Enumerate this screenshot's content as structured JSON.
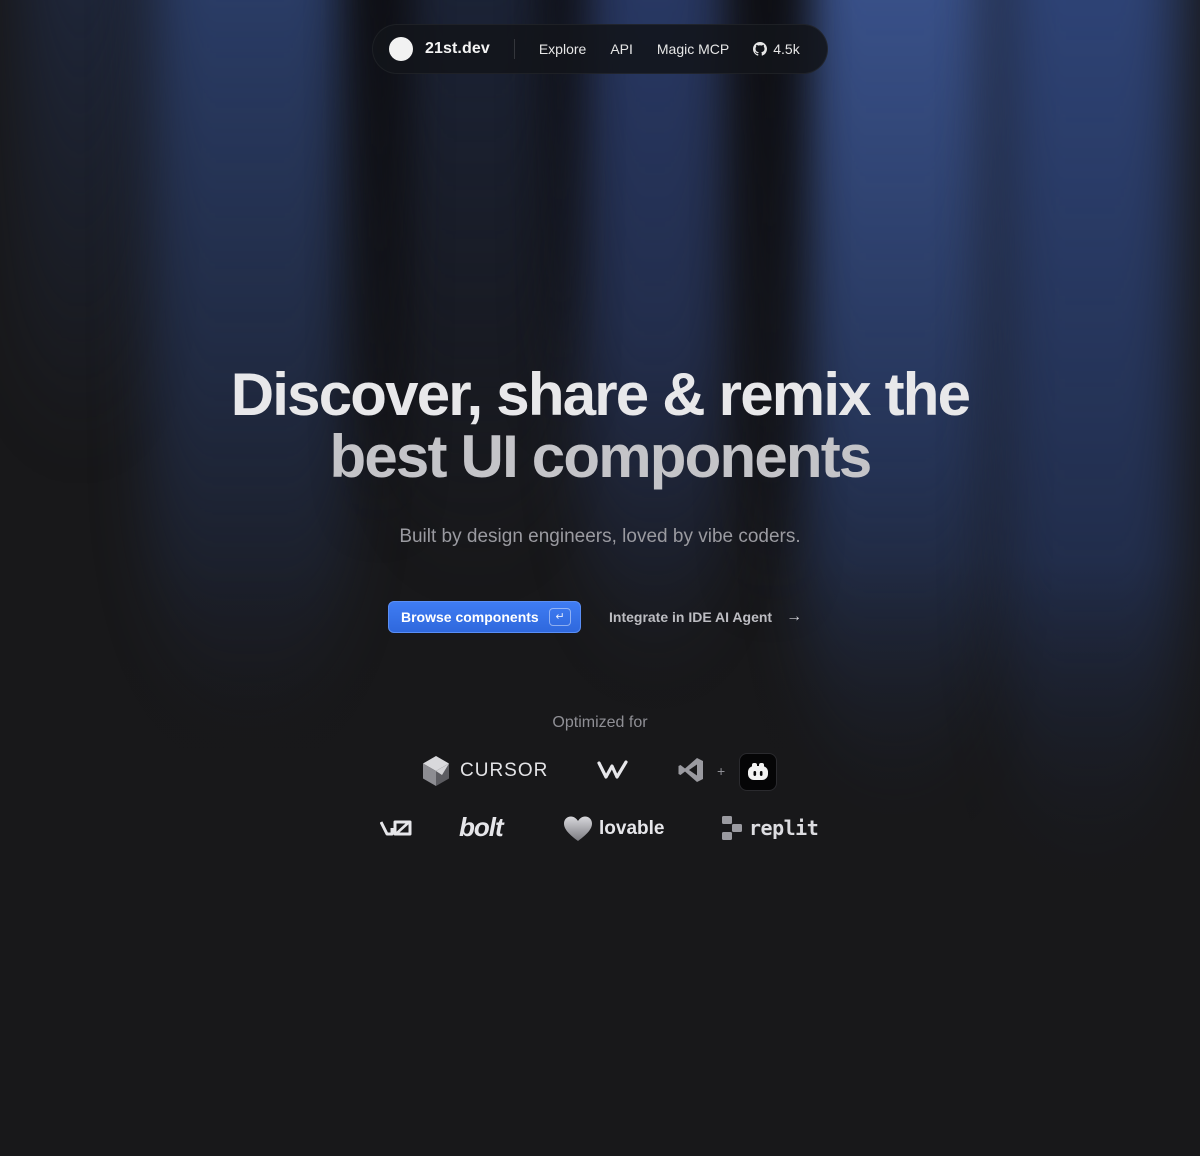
{
  "nav": {
    "brand": "21st.dev",
    "links": [
      "Explore",
      "API",
      "Magic MCP"
    ],
    "github_stars": "4.5k",
    "github_icon": "github-icon"
  },
  "hero": {
    "title_line1": "Discover, share & remix the",
    "title_line2": "best UI components",
    "subtitle": "Built by design engineers, loved by vibe coders."
  },
  "cta": {
    "primary_label": "Browse components",
    "primary_shortcut": "↵",
    "secondary_label": "Integrate in IDE AI Agent",
    "secondary_icon": "arrow-right-icon"
  },
  "optimized": {
    "label": "Optimized for",
    "plus": "+",
    "logos": {
      "cursor": "CURSOR",
      "bolt": "bolt",
      "lovable": "lovable",
      "replit": "replit"
    }
  },
  "colors": {
    "background": "#18181a",
    "primary_button": "#3470e4",
    "accent_blue": "#3a5a9e"
  }
}
